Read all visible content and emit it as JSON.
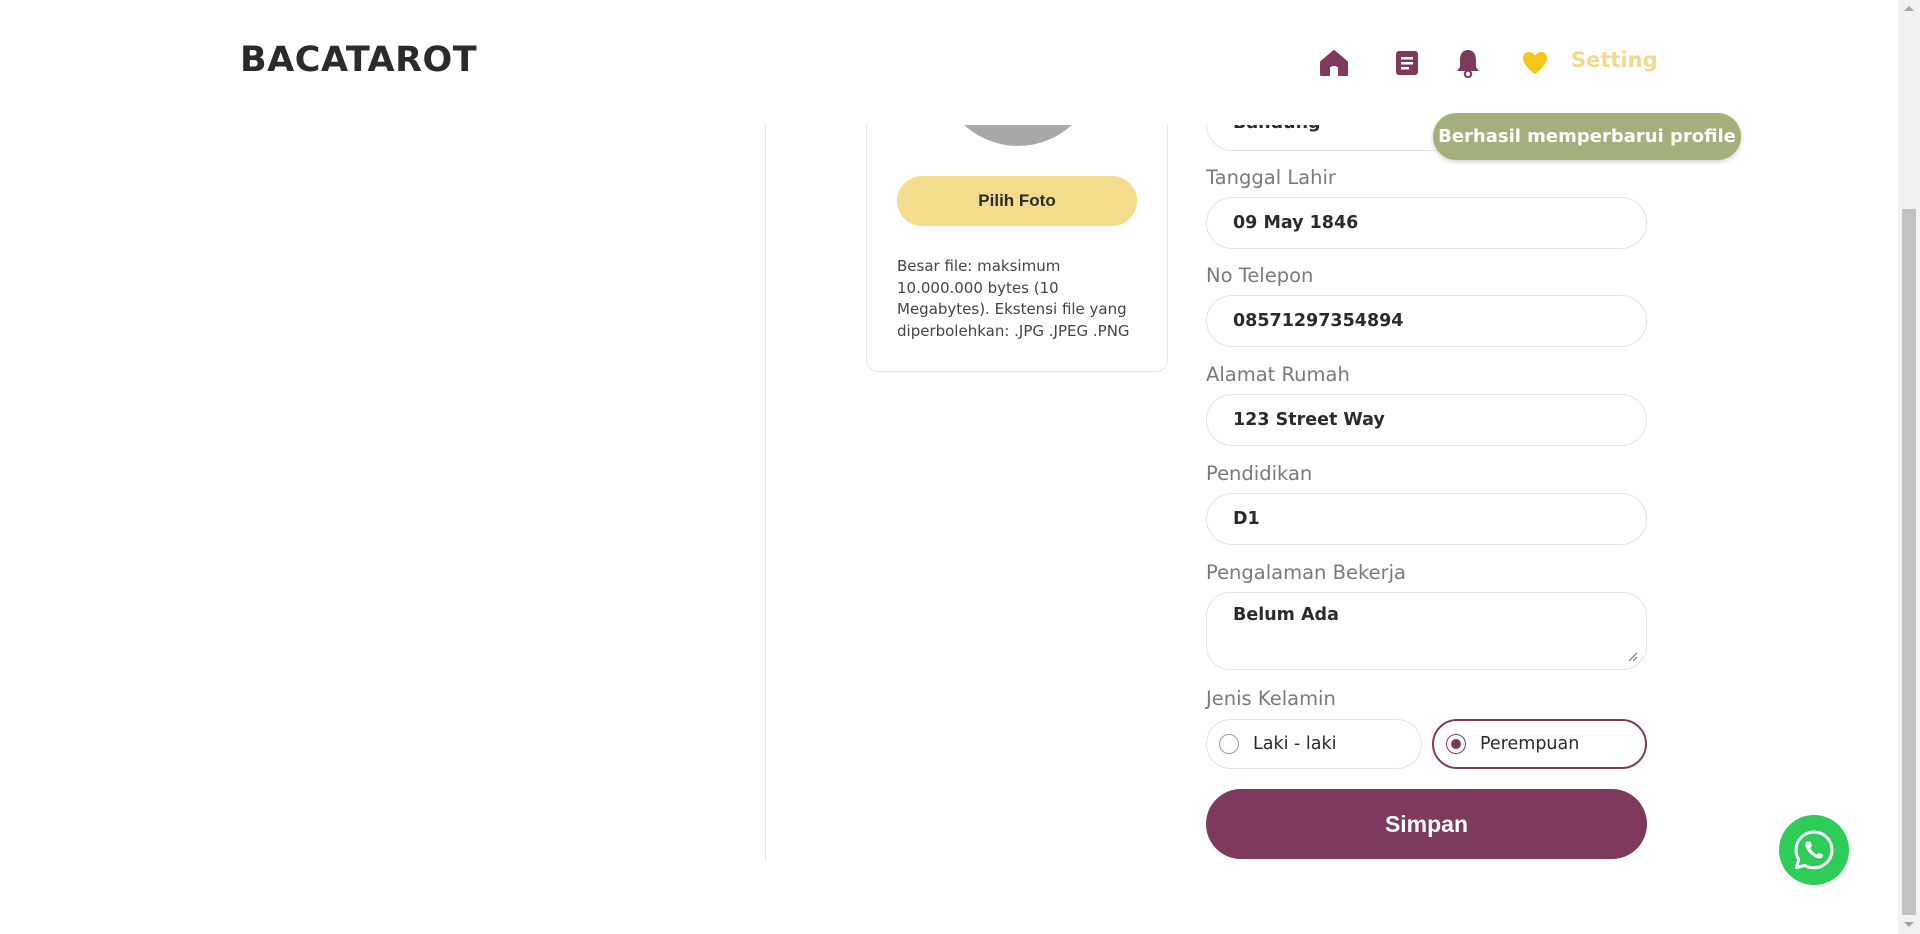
{
  "header": {
    "brand": "BACATAROT",
    "nav": {
      "home_icon": "home-icon",
      "article_icon": "document-icon",
      "notification_icon": "bell-icon",
      "favorite_icon": "heart-icon",
      "setting_label": "Setting"
    }
  },
  "toast": {
    "message": "Berhasil memperbarui profile"
  },
  "photo": {
    "pick_button": "Pilih Foto",
    "file_note": "Besar file: maksimum 10.000.000 bytes (10 Megabytes). Ekstensi file yang diperbolehkan: .JPG .JPEG .PNG"
  },
  "form": {
    "city_value": "Bandung",
    "birthdate": {
      "label": "Tanggal Lahir",
      "value": "09 May 1846"
    },
    "phone": {
      "label": "No Telepon",
      "value": "08571297354894"
    },
    "address": {
      "label": "Alamat Rumah",
      "value": "123 Street Way"
    },
    "education": {
      "label": "Pendidikan",
      "value": "D1"
    },
    "experience": {
      "label": "Pengalaman Bekerja",
      "value": "Belum Ada"
    },
    "gender": {
      "label": "Jenis Kelamin",
      "options": [
        "Laki - laki",
        "Perempuan"
      ],
      "selected": "Perempuan"
    },
    "save_button": "Simpan"
  },
  "colors": {
    "brand_primary": "#7d3a5c",
    "accent_yellow": "#f4dc8d",
    "toast_green": "#a4b07b",
    "whatsapp_green": "#2ecc59"
  },
  "whatsapp": {
    "icon": "whatsapp-icon"
  }
}
